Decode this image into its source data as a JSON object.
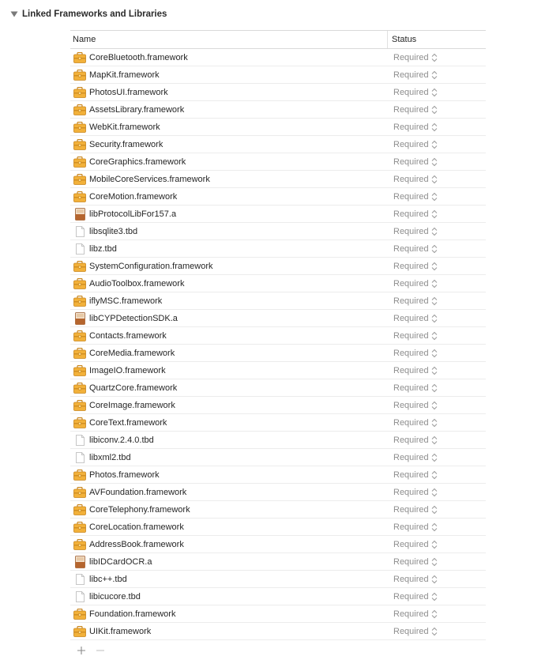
{
  "section": {
    "title": "Linked Frameworks and Libraries"
  },
  "columns": {
    "name": "Name",
    "status": "Status"
  },
  "rows": [
    {
      "name": "CoreBluetooth.framework",
      "icon": "framework-icon",
      "status": "Required"
    },
    {
      "name": "MapKit.framework",
      "icon": "framework-icon",
      "status": "Required"
    },
    {
      "name": "PhotosUI.framework",
      "icon": "framework-icon",
      "status": "Required"
    },
    {
      "name": "AssetsLibrary.framework",
      "icon": "framework-icon",
      "status": "Required"
    },
    {
      "name": "WebKit.framework",
      "icon": "framework-icon",
      "status": "Required"
    },
    {
      "name": "Security.framework",
      "icon": "framework-icon",
      "status": "Required"
    },
    {
      "name": "CoreGraphics.framework",
      "icon": "framework-icon",
      "status": "Required"
    },
    {
      "name": "MobileCoreServices.framework",
      "icon": "framework-icon",
      "status": "Required"
    },
    {
      "name": "CoreMotion.framework",
      "icon": "framework-icon",
      "status": "Required"
    },
    {
      "name": "libProtocolLibFor157.a",
      "icon": "static-library-icon",
      "status": "Required"
    },
    {
      "name": "libsqlite3.tbd",
      "icon": "tbd-file-icon",
      "status": "Required"
    },
    {
      "name": "libz.tbd",
      "icon": "tbd-file-icon",
      "status": "Required"
    },
    {
      "name": "SystemConfiguration.framework",
      "icon": "framework-icon",
      "status": "Required"
    },
    {
      "name": "AudioToolbox.framework",
      "icon": "framework-icon",
      "status": "Required"
    },
    {
      "name": "iflyMSC.framework",
      "icon": "framework-icon",
      "status": "Required"
    },
    {
      "name": "libCYPDetectionSDK.a",
      "icon": "static-library-icon",
      "status": "Required"
    },
    {
      "name": "Contacts.framework",
      "icon": "framework-icon",
      "status": "Required"
    },
    {
      "name": "CoreMedia.framework",
      "icon": "framework-icon",
      "status": "Required"
    },
    {
      "name": "ImageIO.framework",
      "icon": "framework-icon",
      "status": "Required"
    },
    {
      "name": "QuartzCore.framework",
      "icon": "framework-icon",
      "status": "Required"
    },
    {
      "name": "CoreImage.framework",
      "icon": "framework-icon",
      "status": "Required"
    },
    {
      "name": "CoreText.framework",
      "icon": "framework-icon",
      "status": "Required"
    },
    {
      "name": "libiconv.2.4.0.tbd",
      "icon": "tbd-file-icon",
      "status": "Required"
    },
    {
      "name": "libxml2.tbd",
      "icon": "tbd-file-icon",
      "status": "Required"
    },
    {
      "name": "Photos.framework",
      "icon": "framework-icon",
      "status": "Required"
    },
    {
      "name": "AVFoundation.framework",
      "icon": "framework-icon",
      "status": "Required"
    },
    {
      "name": "CoreTelephony.framework",
      "icon": "framework-icon",
      "status": "Required"
    },
    {
      "name": "CoreLocation.framework",
      "icon": "framework-icon",
      "status": "Required"
    },
    {
      "name": "AddressBook.framework",
      "icon": "framework-icon",
      "status": "Required"
    },
    {
      "name": "libIDCardOCR.a",
      "icon": "static-library-icon",
      "status": "Required"
    },
    {
      "name": "libc++.tbd",
      "icon": "tbd-file-icon",
      "status": "Required"
    },
    {
      "name": "libicucore.tbd",
      "icon": "tbd-file-icon",
      "status": "Required"
    },
    {
      "name": "Foundation.framework",
      "icon": "framework-icon",
      "status": "Required"
    },
    {
      "name": "UIKit.framework",
      "icon": "framework-icon",
      "status": "Required"
    }
  ],
  "footer": {
    "add_label": "+",
    "remove_label": "−"
  },
  "colors": {
    "framework": "#f2b13a",
    "framework_dark": "#c9851c",
    "static_lib": "#b5652e",
    "status_text": "#8e8e8e"
  }
}
